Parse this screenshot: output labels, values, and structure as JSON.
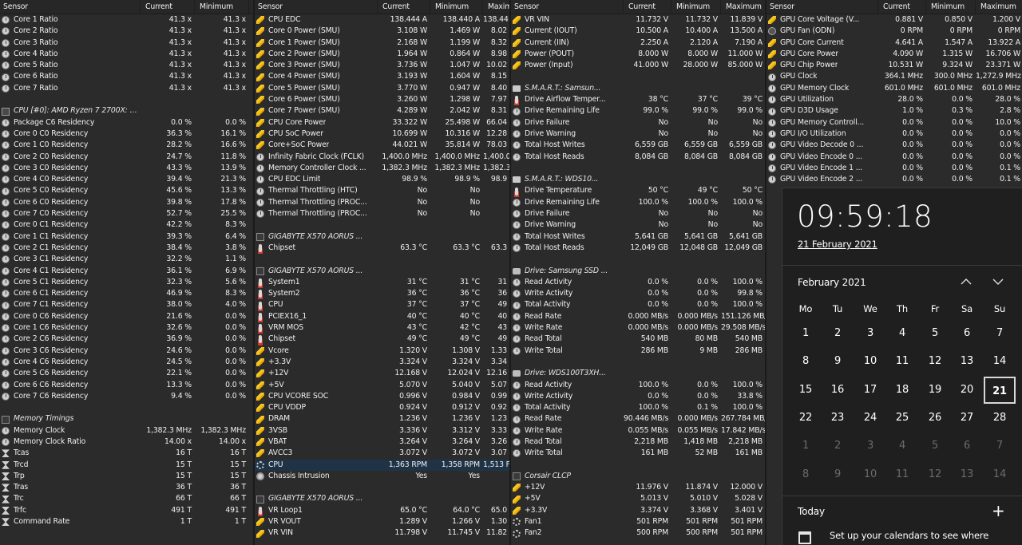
{
  "columns": {
    "sensor": "Sensor",
    "current": "Current",
    "minimum": "Minimum",
    "maximum": "Maximum"
  },
  "panel1": [
    {
      "i": "clock",
      "n": "Core 1 Ratio",
      "c": "41.3 x",
      "m": "41.3 x"
    },
    {
      "i": "clock",
      "n": "Core 2 Ratio",
      "c": "41.3 x",
      "m": "41.3 x"
    },
    {
      "i": "clock",
      "n": "Core 3 Ratio",
      "c": "41.3 x",
      "m": "41.3 x"
    },
    {
      "i": "clock",
      "n": "Core 4 Ratio",
      "c": "41.3 x",
      "m": "41.3 x"
    },
    {
      "i": "clock",
      "n": "Core 5 Ratio",
      "c": "41.3 x",
      "m": "41.3 x"
    },
    {
      "i": "clock",
      "n": "Core 6 Ratio",
      "c": "41.3 x",
      "m": "41.3 x"
    },
    {
      "i": "clock",
      "n": "Core 7 Ratio",
      "c": "41.3 x",
      "m": "41.3 x"
    },
    {
      "i": "",
      "n": "",
      "c": "",
      "m": ""
    },
    {
      "i": "cpu",
      "n": "CPU [#0]: AMD Ryzen 7 2700X: C-S...",
      "c": "",
      "m": "",
      "g": true
    },
    {
      "i": "clock",
      "n": "Package C6 Residency",
      "c": "0.0 %",
      "m": "0.0 %"
    },
    {
      "i": "clock",
      "n": "Core 0 C0 Residency",
      "c": "36.3 %",
      "m": "16.1 %"
    },
    {
      "i": "clock",
      "n": "Core 1 C0 Residency",
      "c": "28.2 %",
      "m": "16.6 %"
    },
    {
      "i": "clock",
      "n": "Core 2 C0 Residency",
      "c": "24.7 %",
      "m": "11.8 %"
    },
    {
      "i": "clock",
      "n": "Core 3 C0 Residency",
      "c": "43.3 %",
      "m": "13.9 %"
    },
    {
      "i": "clock",
      "n": "Core 4 C0 Residency",
      "c": "39.4 %",
      "m": "21.3 %"
    },
    {
      "i": "clock",
      "n": "Core 5 C0 Residency",
      "c": "45.6 %",
      "m": "13.3 %"
    },
    {
      "i": "clock",
      "n": "Core 6 C0 Residency",
      "c": "39.8 %",
      "m": "17.8 %"
    },
    {
      "i": "clock",
      "n": "Core 7 C0 Residency",
      "c": "52.7 %",
      "m": "25.5 %"
    },
    {
      "i": "clock",
      "n": "Core 0 C1 Residency",
      "c": "42.2 %",
      "m": "8.3 %"
    },
    {
      "i": "clock",
      "n": "Core 1 C1 Residency",
      "c": "39.3 %",
      "m": "6.4 %"
    },
    {
      "i": "clock",
      "n": "Core 2 C1 Residency",
      "c": "38.4 %",
      "m": "3.8 %"
    },
    {
      "i": "clock",
      "n": "Core 3 C1 Residency",
      "c": "32.2 %",
      "m": "1.1 %"
    },
    {
      "i": "clock",
      "n": "Core 4 C1 Residency",
      "c": "36.1 %",
      "m": "6.9 %"
    },
    {
      "i": "clock",
      "n": "Core 5 C1 Residency",
      "c": "32.3 %",
      "m": "5.6 %"
    },
    {
      "i": "clock",
      "n": "Core 6 C1 Residency",
      "c": "46.9 %",
      "m": "8.3 %"
    },
    {
      "i": "clock",
      "n": "Core 7 C1 Residency",
      "c": "38.0 %",
      "m": "4.0 %"
    },
    {
      "i": "clock",
      "n": "Core 0 C6 Residency",
      "c": "21.6 %",
      "m": "0.0 %"
    },
    {
      "i": "clock",
      "n": "Core 1 C6 Residency",
      "c": "32.6 %",
      "m": "0.0 %"
    },
    {
      "i": "clock",
      "n": "Core 2 C6 Residency",
      "c": "36.9 %",
      "m": "0.0 %"
    },
    {
      "i": "clock",
      "n": "Core 3 C6 Residency",
      "c": "24.6 %",
      "m": "0.0 %"
    },
    {
      "i": "clock",
      "n": "Core 4 C6 Residency",
      "c": "24.5 %",
      "m": "0.0 %"
    },
    {
      "i": "clock",
      "n": "Core 5 C6 Residency",
      "c": "22.1 %",
      "m": "0.0 %"
    },
    {
      "i": "clock",
      "n": "Core 6 C6 Residency",
      "c": "13.3 %",
      "m": "0.0 %"
    },
    {
      "i": "clock",
      "n": "Core 7 C6 Residency",
      "c": "9.4 %",
      "m": "0.0 %"
    },
    {
      "i": "",
      "n": "",
      "c": "",
      "m": ""
    },
    {
      "i": "chip",
      "n": "Memory Timings",
      "c": "",
      "m": "",
      "g": true
    },
    {
      "i": "clock",
      "n": "Memory Clock",
      "c": "1,382.3 MHz",
      "m": "1,382.3 MHz"
    },
    {
      "i": "clock",
      "n": "Memory Clock Ratio",
      "c": "14.00 x",
      "m": "14.00 x"
    },
    {
      "i": "hourglass",
      "n": "Tcas",
      "c": "16 T",
      "m": "16 T"
    },
    {
      "i": "hourglass",
      "n": "Trcd",
      "c": "15 T",
      "m": "15 T"
    },
    {
      "i": "hourglass",
      "n": "Trp",
      "c": "15 T",
      "m": "15 T"
    },
    {
      "i": "hourglass",
      "n": "Tras",
      "c": "36 T",
      "m": "36 T"
    },
    {
      "i": "hourglass",
      "n": "Trc",
      "c": "66 T",
      "m": "66 T"
    },
    {
      "i": "hourglass",
      "n": "Trfc",
      "c": "491 T",
      "m": "491 T"
    },
    {
      "i": "hourglass",
      "n": "Command Rate",
      "c": "1 T",
      "m": "1 T"
    }
  ],
  "panel2": [
    {
      "i": "bolt",
      "n": "CPU EDC",
      "c": "138.444 A",
      "m": "138.440 A",
      "x": "138.44"
    },
    {
      "i": "bolt",
      "n": "Core 0 Power (SMU)",
      "c": "3.108 W",
      "m": "1.469 W",
      "x": "8.02"
    },
    {
      "i": "bolt",
      "n": "Core 1 Power (SMU)",
      "c": "2.168 W",
      "m": "1.199 W",
      "x": "8.32"
    },
    {
      "i": "bolt",
      "n": "Core 2 Power (SMU)",
      "c": "1.964 W",
      "m": "0.864 W",
      "x": "8.98"
    },
    {
      "i": "bolt",
      "n": "Core 3 Power (SMU)",
      "c": "3.736 W",
      "m": "1.047 W",
      "x": "10.02"
    },
    {
      "i": "bolt",
      "n": "Core 4 Power (SMU)",
      "c": "3.193 W",
      "m": "1.604 W",
      "x": "8.15"
    },
    {
      "i": "bolt",
      "n": "Core 5 Power (SMU)",
      "c": "3.770 W",
      "m": "0.947 W",
      "x": "8.40"
    },
    {
      "i": "bolt",
      "n": "Core 6 Power (SMU)",
      "c": "3.260 W",
      "m": "1.298 W",
      "x": "7.97"
    },
    {
      "i": "bolt",
      "n": "Core 7 Power (SMU)",
      "c": "4.289 W",
      "m": "2.042 W",
      "x": "8.31"
    },
    {
      "i": "bolt",
      "n": "CPU Core Power",
      "c": "33.322 W",
      "m": "25.498 W",
      "x": "66.04"
    },
    {
      "i": "bolt",
      "n": "CPU SoC Power",
      "c": "10.699 W",
      "m": "10.316 W",
      "x": "12.28"
    },
    {
      "i": "bolt",
      "n": "Core+SoC Power",
      "c": "44.021 W",
      "m": "35.814 W",
      "x": "78.03"
    },
    {
      "i": "clock",
      "n": "Infinity Fabric Clock (FCLK)",
      "c": "1,400.0 MHz",
      "m": "1,400.0 MHz",
      "x": "1,400.0 M"
    },
    {
      "i": "clock",
      "n": "Memory Controller Clock ...",
      "c": "1,382.3 MHz",
      "m": "1,382.3 MHz",
      "x": "1,382.3 M"
    },
    {
      "i": "clock",
      "n": "CPU EDC Limit",
      "c": "98.9 %",
      "m": "98.9 %",
      "x": "98.9"
    },
    {
      "i": "clock",
      "n": "Thermal Throttling (HTC)",
      "c": "No",
      "m": "No",
      "x": ""
    },
    {
      "i": "clock",
      "n": "Thermal Throttling (PROC...",
      "c": "No",
      "m": "No",
      "x": ""
    },
    {
      "i": "clock",
      "n": "Thermal Throttling (PROC...",
      "c": "No",
      "m": "No",
      "x": ""
    },
    {
      "i": "",
      "n": "",
      "c": "",
      "m": "",
      "x": ""
    },
    {
      "i": "chip",
      "n": "GIGABYTE X570 AORUS ...",
      "c": "",
      "m": "",
      "x": "",
      "g": true
    },
    {
      "i": "therm",
      "n": "Chipset",
      "c": "63.3 °C",
      "m": "63.3 °C",
      "x": "63.3"
    },
    {
      "i": "",
      "n": "",
      "c": "",
      "m": "",
      "x": ""
    },
    {
      "i": "chip",
      "n": "GIGABYTE X570 AORUS ...",
      "c": "",
      "m": "",
      "x": "",
      "g": true
    },
    {
      "i": "therm",
      "n": "System1",
      "c": "31 °C",
      "m": "31 °C",
      "x": "31"
    },
    {
      "i": "therm",
      "n": "System2",
      "c": "36 °C",
      "m": "36 °C",
      "x": "36"
    },
    {
      "i": "therm",
      "n": "CPU",
      "c": "37 °C",
      "m": "37 °C",
      "x": "49"
    },
    {
      "i": "therm",
      "n": "PCIEX16_1",
      "c": "40 °C",
      "m": "40 °C",
      "x": "40"
    },
    {
      "i": "therm",
      "n": "VRM MOS",
      "c": "43 °C",
      "m": "42 °C",
      "x": "43"
    },
    {
      "i": "therm",
      "n": "Chipset",
      "c": "49 °C",
      "m": "49 °C",
      "x": "49"
    },
    {
      "i": "bolt",
      "n": "Vcore",
      "c": "1.320 V",
      "m": "1.308 V",
      "x": "1.33"
    },
    {
      "i": "bolt",
      "n": "+3.3V",
      "c": "3.324 V",
      "m": "3.324 V",
      "x": "3.34"
    },
    {
      "i": "bolt",
      "n": "+12V",
      "c": "12.168 V",
      "m": "12.024 V",
      "x": "12.16"
    },
    {
      "i": "bolt",
      "n": "+5V",
      "c": "5.070 V",
      "m": "5.040 V",
      "x": "5.07"
    },
    {
      "i": "bolt",
      "n": "CPU VCORE SOC",
      "c": "0.996 V",
      "m": "0.984 V",
      "x": "0.99"
    },
    {
      "i": "bolt",
      "n": "CPU VDDP",
      "c": "0.924 V",
      "m": "0.912 V",
      "x": "0.92"
    },
    {
      "i": "bolt",
      "n": "DRAM",
      "c": "1.236 V",
      "m": "1.236 V",
      "x": "1.23"
    },
    {
      "i": "bolt",
      "n": "3VSB",
      "c": "3.336 V",
      "m": "3.312 V",
      "x": "3.33"
    },
    {
      "i": "bolt",
      "n": "VBAT",
      "c": "3.264 V",
      "m": "3.264 V",
      "x": "3.26"
    },
    {
      "i": "bolt",
      "n": "AVCC3",
      "c": "3.072 V",
      "m": "3.072 V",
      "x": "3.07"
    },
    {
      "i": "fan",
      "n": "CPU",
      "c": "1,363 RPM",
      "m": "1,358 RPM",
      "x": "1,513 F",
      "sel": true
    },
    {
      "i": "shield",
      "n": "Chassis Intrusion",
      "c": "Yes",
      "m": "Yes",
      "x": ""
    },
    {
      "i": "",
      "n": "",
      "c": "",
      "m": "",
      "x": ""
    },
    {
      "i": "chip",
      "n": "GIGABYTE X570 AORUS ...",
      "c": "",
      "m": "",
      "x": "",
      "g": true
    },
    {
      "i": "therm",
      "n": "VR Loop1",
      "c": "65.0 °C",
      "m": "64.0 °C",
      "x": "65.0"
    },
    {
      "i": "bolt",
      "n": "VR VOUT",
      "c": "1.289 V",
      "m": "1.266 V",
      "x": "1.30"
    },
    {
      "i": "bolt",
      "n": "VR VIN",
      "c": "11.798 V",
      "m": "11.745 V",
      "x": "11.82"
    }
  ],
  "panel3": [
    {
      "i": "bolt",
      "n": "VR VIN",
      "c": "11.732 V",
      "m": "11.732 V",
      "x": "11.839 V"
    },
    {
      "i": "bolt",
      "n": "Current (IOUT)",
      "c": "10.500 A",
      "m": "10.400 A",
      "x": "13.500 A"
    },
    {
      "i": "bolt",
      "n": "Current (IIN)",
      "c": "2.250 A",
      "m": "2.120 A",
      "x": "7.190 A"
    },
    {
      "i": "bolt",
      "n": "Power (POUT)",
      "c": "8.000 W",
      "m": "8.000 W",
      "x": "11.000 W"
    },
    {
      "i": "bolt",
      "n": "Power (Input)",
      "c": "41.000 W",
      "m": "28.000 W",
      "x": "85.000 W"
    },
    {
      "i": "",
      "n": "",
      "c": "",
      "m": "",
      "x": ""
    },
    {
      "i": "drive",
      "n": "S.M.A.R.T.: Samsun...",
      "c": "",
      "m": "",
      "x": "",
      "g": true
    },
    {
      "i": "therm",
      "n": "Drive Airflow Temper...",
      "c": "38 °C",
      "m": "37 °C",
      "x": "39 °C"
    },
    {
      "i": "clock",
      "n": "Drive Remaining Life",
      "c": "99.0 %",
      "m": "99.0 %",
      "x": "99.0 %"
    },
    {
      "i": "clock",
      "n": "Drive Failure",
      "c": "No",
      "m": "No",
      "x": "No"
    },
    {
      "i": "clock",
      "n": "Drive Warning",
      "c": "No",
      "m": "No",
      "x": "No"
    },
    {
      "i": "clock",
      "n": "Total Host Writes",
      "c": "6,559 GB",
      "m": "6,559 GB",
      "x": "6,559 GB"
    },
    {
      "i": "clock",
      "n": "Total Host Reads",
      "c": "8,084 GB",
      "m": "8,084 GB",
      "x": "8,084 GB"
    },
    {
      "i": "",
      "n": "",
      "c": "",
      "m": "",
      "x": ""
    },
    {
      "i": "drive",
      "n": "S.M.A.R.T.: WDS10...",
      "c": "",
      "m": "",
      "x": "",
      "g": true
    },
    {
      "i": "therm",
      "n": "Drive Temperature",
      "c": "50 °C",
      "m": "49 °C",
      "x": "50 °C"
    },
    {
      "i": "clock",
      "n": "Drive Remaining Life",
      "c": "100.0 %",
      "m": "100.0 %",
      "x": "100.0 %"
    },
    {
      "i": "clock",
      "n": "Drive Failure",
      "c": "No",
      "m": "No",
      "x": "No"
    },
    {
      "i": "clock",
      "n": "Drive Warning",
      "c": "No",
      "m": "No",
      "x": "No"
    },
    {
      "i": "clock",
      "n": "Total Host Writes",
      "c": "5,641 GB",
      "m": "5,641 GB",
      "x": "5,641 GB"
    },
    {
      "i": "clock",
      "n": "Total Host Reads",
      "c": "12,049 GB",
      "m": "12,048 GB",
      "x": "12,049 GB"
    },
    {
      "i": "",
      "n": "",
      "c": "",
      "m": "",
      "x": ""
    },
    {
      "i": "hdd",
      "n": "Drive: Samsung SSD ...",
      "c": "",
      "m": "",
      "x": "",
      "g": true
    },
    {
      "i": "clock",
      "n": "Read Activity",
      "c": "0.0 %",
      "m": "0.0 %",
      "x": "100.0 %"
    },
    {
      "i": "clock",
      "n": "Write Activity",
      "c": "0.0 %",
      "m": "0.0 %",
      "x": "99.8 %"
    },
    {
      "i": "clock",
      "n": "Total Activity",
      "c": "0.0 %",
      "m": "0.0 %",
      "x": "100.0 %"
    },
    {
      "i": "clock",
      "n": "Read Rate",
      "c": "0.000 MB/s",
      "m": "0.000 MB/s",
      "x": "151.126 MB/s"
    },
    {
      "i": "clock",
      "n": "Write Rate",
      "c": "0.000 MB/s",
      "m": "0.000 MB/s",
      "x": "29.508 MB/s"
    },
    {
      "i": "clock",
      "n": "Read Total",
      "c": "540 MB",
      "m": "80 MB",
      "x": "540 MB"
    },
    {
      "i": "clock",
      "n": "Write Total",
      "c": "286 MB",
      "m": "9 MB",
      "x": "286 MB"
    },
    {
      "i": "",
      "n": "",
      "c": "",
      "m": "",
      "x": ""
    },
    {
      "i": "hdd",
      "n": "Drive: WDS100T3XH...",
      "c": "",
      "m": "",
      "x": "",
      "g": true
    },
    {
      "i": "clock",
      "n": "Read Activity",
      "c": "100.0 %",
      "m": "0.0 %",
      "x": "100.0 %"
    },
    {
      "i": "clock",
      "n": "Write Activity",
      "c": "0.0 %",
      "m": "0.0 %",
      "x": "33.8 %"
    },
    {
      "i": "clock",
      "n": "Total Activity",
      "c": "100.0 %",
      "m": "0.1 %",
      "x": "100.0 %"
    },
    {
      "i": "clock",
      "n": "Read Rate",
      "c": "90.446 MB/s",
      "m": "0.000 MB/s",
      "x": "267.784 MB/s"
    },
    {
      "i": "clock",
      "n": "Write Rate",
      "c": "0.055 MB/s",
      "m": "0.055 MB/s",
      "x": "17.842 MB/s"
    },
    {
      "i": "clock",
      "n": "Read Total",
      "c": "2,218 MB",
      "m": "1,418 MB",
      "x": "2,218 MB"
    },
    {
      "i": "clock",
      "n": "Write Total",
      "c": "161 MB",
      "m": "52 MB",
      "x": "161 MB"
    },
    {
      "i": "",
      "n": "",
      "c": "",
      "m": "",
      "x": ""
    },
    {
      "i": "chip",
      "n": "Corsair CLCP",
      "c": "",
      "m": "",
      "x": "",
      "g": true
    },
    {
      "i": "bolt",
      "n": "+12V",
      "c": "11.976 V",
      "m": "11.874 V",
      "x": "12.000 V"
    },
    {
      "i": "bolt",
      "n": "+5V",
      "c": "5.013 V",
      "m": "5.010 V",
      "x": "5.028 V"
    },
    {
      "i": "bolt",
      "n": "+3.3V",
      "c": "3.374 V",
      "m": "3.368 V",
      "x": "3.401 V"
    },
    {
      "i": "fan",
      "n": "Fan1",
      "c": "501 RPM",
      "m": "501 RPM",
      "x": "501 RPM"
    },
    {
      "i": "fan",
      "n": "Fan2",
      "c": "500 RPM",
      "m": "500 RPM",
      "x": "501 RPM"
    }
  ],
  "panel4": [
    {
      "i": "bolt",
      "n": "GPU Core Voltage (V...",
      "c": "0.881 V",
      "m": "0.850 V",
      "x": "1.200 V"
    },
    {
      "i": "gfan",
      "n": "GPU Fan (ODN)",
      "c": "0 RPM",
      "m": "0 RPM",
      "x": "0 RPM"
    },
    {
      "i": "bolt",
      "n": "GPU Core Current",
      "c": "4.641 A",
      "m": "1.547 A",
      "x": "13.922 A"
    },
    {
      "i": "bolt",
      "n": "GPU Core Power",
      "c": "4.090 W",
      "m": "1.315 W",
      "x": "16.706 W"
    },
    {
      "i": "bolt",
      "n": "GPU Chip Power",
      "c": "10.531 W",
      "m": "9.324 W",
      "x": "23.371 W"
    },
    {
      "i": "clock",
      "n": "GPU Clock",
      "c": "364.1 MHz",
      "m": "300.0 MHz",
      "x": "1,272.9 MHz"
    },
    {
      "i": "clock",
      "n": "GPU Memory Clock",
      "c": "601.0 MHz",
      "m": "601.0 MHz",
      "x": "601.0 MHz"
    },
    {
      "i": "clock",
      "n": "GPU Utilization",
      "c": "28.0 %",
      "m": "0.0 %",
      "x": "28.0 %"
    },
    {
      "i": "clock",
      "n": "GPU D3D Usage",
      "c": "1.0 %",
      "m": "0.3 %",
      "x": "2.8 %"
    },
    {
      "i": "clock",
      "n": "GPU Memory Controll...",
      "c": "0.0 %",
      "m": "0.0 %",
      "x": "10.0 %"
    },
    {
      "i": "clock",
      "n": "GPU I/O Utilization",
      "c": "0.0 %",
      "m": "0.0 %",
      "x": "0.0 %"
    },
    {
      "i": "clock",
      "n": "GPU Video Decode 0 ...",
      "c": "0.0 %",
      "m": "0.0 %",
      "x": "0.0 %"
    },
    {
      "i": "clock",
      "n": "GPU Video Encode 0 ...",
      "c": "0.0 %",
      "m": "0.0 %",
      "x": "0.0 %"
    },
    {
      "i": "clock",
      "n": "GPU Video Encode 1 ...",
      "c": "0.0 %",
      "m": "0.0 %",
      "x": "0.1 %"
    },
    {
      "i": "clock",
      "n": "GPU Video Encode 2 ...",
      "c": "0.0 %",
      "m": "0.0 %",
      "x": "0.1 %"
    }
  ],
  "clock_flyout": {
    "time": "09:59:18",
    "date": "21 February 2021",
    "month": "February 2021",
    "weekdays": [
      "Mo",
      "Tu",
      "We",
      "Th",
      "Fr",
      "Sa",
      "Su"
    ],
    "weeks": [
      [
        "1",
        "2",
        "3",
        "4",
        "5",
        "6",
        "7"
      ],
      [
        "8",
        "9",
        "10",
        "11",
        "12",
        "13",
        "14"
      ],
      [
        "15",
        "16",
        "17",
        "18",
        "19",
        "20",
        "21"
      ],
      [
        "22",
        "23",
        "24",
        "25",
        "26",
        "27",
        "28"
      ],
      [
        "1",
        "2",
        "3",
        "4",
        "5",
        "6",
        "7"
      ],
      [
        "8",
        "9",
        "10",
        "11",
        "12",
        "13",
        "14"
      ]
    ],
    "today_day": "21",
    "agenda_title": "Today",
    "setup_text": "Set up your calendars to see where"
  }
}
